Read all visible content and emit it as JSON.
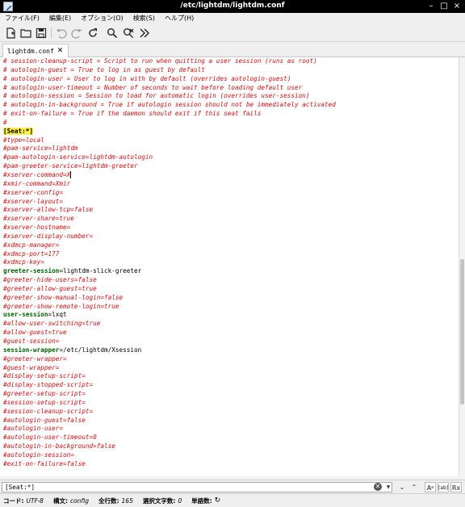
{
  "window": {
    "title": "/etc/lightdm/lightdm.conf",
    "minimize": "–",
    "maximize": "□",
    "close": "×"
  },
  "menu": {
    "items": [
      "ファイル(F)",
      "編集(E)",
      "オプション(O)",
      "検索(S)",
      "ヘルプ(H)"
    ]
  },
  "toolbar": {
    "icons": [
      "new-file-icon",
      "open-folder-icon",
      "save-icon",
      "undo-icon",
      "redo-icon",
      "reload-icon",
      "find-icon",
      "replace-icon",
      "goto-line-icon"
    ]
  },
  "tab": {
    "label": "lightdm.conf",
    "close": "✕"
  },
  "editor": {
    "lines": [
      {
        "t": "cm",
        "text": "# session-cleanup-script = Script to run when quitting a user session (runs as root)"
      },
      {
        "t": "cm",
        "text": "# autologin-guest = True to log in as guest by default"
      },
      {
        "t": "cm",
        "text": "# autologin-user = User to log in with by default (overrides autologin-guest)"
      },
      {
        "t": "cm",
        "text": "# autologin-user-timeout = Number of seconds to wait before loading default user"
      },
      {
        "t": "cm",
        "text": "# autologin-session = Session to load for automatic login (overrides user-session)"
      },
      {
        "t": "cm",
        "text": "# autologin-in-background = True if autologin session should not be immediately activated"
      },
      {
        "t": "cm",
        "text": "# exit-on-failure = True if the daemon should exit if this seat fails"
      },
      {
        "t": "cm",
        "text": "#"
      },
      {
        "t": "sec",
        "text": "[Seat:*]"
      },
      {
        "t": "cm",
        "text": "#type=local"
      },
      {
        "t": "cm",
        "text": "#pam-service=lightdm"
      },
      {
        "t": "cm",
        "text": "#pam-autologin-service=lightdm-autologin"
      },
      {
        "t": "cm",
        "text": "#pam-greeter-service=lightdm-greeter"
      },
      {
        "t": "cm",
        "text": "#xserver-command=X",
        "caret": true
      },
      {
        "t": "cm",
        "text": "#xmir-command=Xmir"
      },
      {
        "t": "cm",
        "text": "#xserver-config="
      },
      {
        "t": "cm",
        "text": "#xserver-layout="
      },
      {
        "t": "cm",
        "text": "#xserver-allow-tcp=false"
      },
      {
        "t": "cm",
        "text": "#xserver-share=true"
      },
      {
        "t": "cm",
        "text": "#xserver-hostname="
      },
      {
        "t": "cm",
        "text": "#xserver-display-number="
      },
      {
        "t": "cm",
        "text": "#xdmcp-manager="
      },
      {
        "t": "cm",
        "text": "#xdmcp-port=177"
      },
      {
        "t": "cm",
        "text": "#xdmcp-key="
      },
      {
        "t": "kv",
        "key": "greeter-session",
        "val": "=lightdm-slick-greeter"
      },
      {
        "t": "cm",
        "text": "#greeter-hide-users=false"
      },
      {
        "t": "cm",
        "text": "#greeter-allow-guest=true"
      },
      {
        "t": "cm",
        "text": "#greeter-show-manual-login=false"
      },
      {
        "t": "cm",
        "text": "#greeter-show-remote-login=true"
      },
      {
        "t": "kv",
        "key": "user-session",
        "val": "=lxqt"
      },
      {
        "t": "cm",
        "text": "#allow-user-switching=true"
      },
      {
        "t": "cm",
        "text": "#allow-guest=true"
      },
      {
        "t": "cm",
        "text": "#guest-session="
      },
      {
        "t": "kv",
        "key": "session-wrapper",
        "val": "=/etc/lightdm/Xsession"
      },
      {
        "t": "cm",
        "text": "#greeter-wrapper="
      },
      {
        "t": "cm",
        "text": "#guest-wrapper="
      },
      {
        "t": "cm",
        "text": "#display-setup-script="
      },
      {
        "t": "cm",
        "text": "#display-stopped-script="
      },
      {
        "t": "cm",
        "text": "#greeter-setup-script="
      },
      {
        "t": "cm",
        "text": "#session-setup-script="
      },
      {
        "t": "cm",
        "text": "#session-cleanup-script="
      },
      {
        "t": "cm",
        "text": "#autologin-guest=false"
      },
      {
        "t": "cm",
        "text": "#autologin-user="
      },
      {
        "t": "cm",
        "text": "#autologin-user-timeout=0"
      },
      {
        "t": "cm",
        "text": "#autologin-in-background=false"
      },
      {
        "t": "cm",
        "text": "#autologin-session="
      },
      {
        "t": "cm",
        "text": "#exit-on-failure=false"
      }
    ]
  },
  "find": {
    "value": "[Seat:*]",
    "clear": "✕",
    "dropdown": "▼",
    "prev": "⌄",
    "next": "⌃",
    "match_case": "Aᵃ",
    "whole_word": "[ab]",
    "regex": "Rx"
  },
  "status": {
    "encoding_label": "コード:",
    "encoding_value": "UTF-8",
    "syntax_label": "構文:",
    "syntax_value": "config",
    "lines_label": "全行数:",
    "lines_value": "165",
    "selected_label": "選択文字数:",
    "selected_value": "0",
    "words_label": "単語数:",
    "refresh_icon": "↻"
  },
  "colors": {
    "comment": "#d01010",
    "key": "#006400",
    "section_highlight": "#ffef4a",
    "titlebar": "#000000",
    "chrome": "#efefef"
  }
}
